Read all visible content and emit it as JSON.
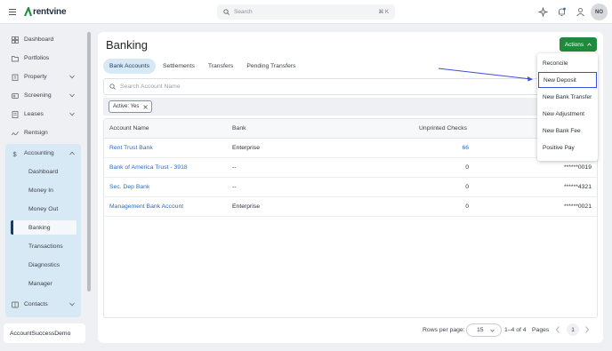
{
  "app": {
    "brand": "rentvine",
    "user_initials": "NO"
  },
  "search": {
    "placeholder": "Search",
    "shortcut": "⌘ K"
  },
  "sidebar": {
    "items": [
      {
        "label": "Dashboard",
        "icon": "dashboard-icon"
      },
      {
        "label": "Portfolios",
        "icon": "folder-icon"
      },
      {
        "label": "Property",
        "icon": "building-icon"
      },
      {
        "label": "Screening",
        "icon": "screening-icon"
      },
      {
        "label": "Leases",
        "icon": "lease-icon"
      },
      {
        "label": "Rentsign",
        "icon": "signature-icon"
      },
      {
        "label": "Accounting",
        "icon": "dollar-icon"
      },
      {
        "label": "Contacts",
        "icon": "contacts-icon"
      }
    ],
    "accounting_sub": [
      {
        "label": "Dashboard"
      },
      {
        "label": "Money In"
      },
      {
        "label": "Money Out"
      },
      {
        "label": "Banking"
      },
      {
        "label": "Transactions"
      },
      {
        "label": "Diagnostics"
      },
      {
        "label": "Manager"
      }
    ],
    "account_name": "AccountSuccessDemo"
  },
  "main": {
    "title": "Banking",
    "actions_label": "Actions",
    "tabs": [
      {
        "label": "Bank Accounts"
      },
      {
        "label": "Settlements"
      },
      {
        "label": "Transfers"
      },
      {
        "label": "Pending Transfers"
      }
    ],
    "search_placeholder": "Search Account Name",
    "filter_chip": "Active: Yes",
    "table": {
      "columns": [
        "Account Name",
        "Bank",
        "Unprinted Checks"
      ],
      "rows": [
        {
          "name": "Rent Trust Bank",
          "bank": "Enterprise",
          "unprinted": "66",
          "account": ""
        },
        {
          "name": "Bank of America Trust - 3918",
          "bank": "--",
          "unprinted": "0",
          "account": "******0019"
        },
        {
          "name": "Sec. Dep Bank",
          "bank": "--",
          "unprinted": "0",
          "account": "******4321"
        },
        {
          "name": "Management Bank Account",
          "bank": "Enterprise",
          "unprinted": "0",
          "account": "******0021"
        }
      ]
    },
    "pagination": {
      "rows_per_page_label": "Rows per page:",
      "rows_per_page": "15",
      "range": "1–4 of 4",
      "pages_label": "Pages",
      "current_page": "1"
    }
  },
  "actions_menu": {
    "items": [
      {
        "label": "Reconcile"
      },
      {
        "label": "New Deposit"
      },
      {
        "label": "New Bank Transfer"
      },
      {
        "label": "New Adjustment"
      },
      {
        "label": "New Bank Fee"
      },
      {
        "label": "Positive Pay"
      }
    ]
  },
  "colors": {
    "primary_green": "#1f8a3b",
    "link_blue": "#2b6cc4",
    "active_nav_bg": "#d8e9f6",
    "highlight_border": "#3b4fd8"
  }
}
